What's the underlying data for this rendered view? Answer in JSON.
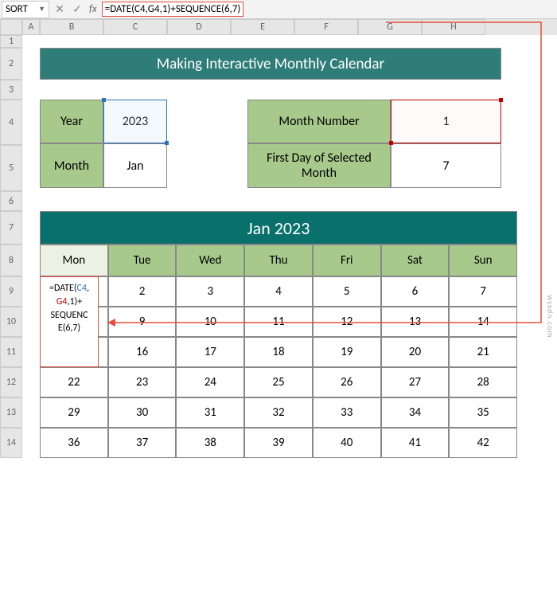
{
  "namebox": "SORT",
  "formula_bar": "=DATE(C4,G4,1)+SEQUENCE(6,7)",
  "columns": [
    "A",
    "B",
    "C",
    "D",
    "E",
    "F",
    "G",
    "H"
  ],
  "rows": [
    "1",
    "2",
    "3",
    "4",
    "5",
    "6",
    "7",
    "8",
    "9",
    "10",
    "11",
    "12",
    "13",
    "14"
  ],
  "title": "Making Interactive Monthly Calendar",
  "params": {
    "year_label": "Year",
    "year_value": "2023",
    "month_label": "Month",
    "month_value": "Jan",
    "month_num_label": "Month Number",
    "month_num_value": "1",
    "firstday_label": "First Day of Selected Month",
    "firstday_value": "7"
  },
  "cal_title": "Jan 2023",
  "weekdays": [
    "Mon",
    "Tue",
    "Wed",
    "Thu",
    "Fri",
    "Sat",
    "Sun"
  ],
  "cal_rows": [
    [
      "",
      "2",
      "3",
      "4",
      "5",
      "6",
      "7"
    ],
    [
      "",
      "9",
      "10",
      "11",
      "12",
      "13",
      "14"
    ],
    [
      "",
      "16",
      "17",
      "18",
      "19",
      "20",
      "21"
    ],
    [
      "22",
      "23",
      "24",
      "25",
      "26",
      "27",
      "28"
    ],
    [
      "29",
      "30",
      "31",
      "32",
      "33",
      "34",
      "35"
    ],
    [
      "36",
      "37",
      "38",
      "39",
      "40",
      "41",
      "42"
    ]
  ],
  "b9_formula": {
    "p1": "=DATE(",
    "c4": "C4",
    "comma": ",",
    "g4": "G4",
    "rest": ",1)+",
    "line2": "SEQUENC",
    "line3": "E(6,7)"
  },
  "watermark": "wsxdn.com"
}
